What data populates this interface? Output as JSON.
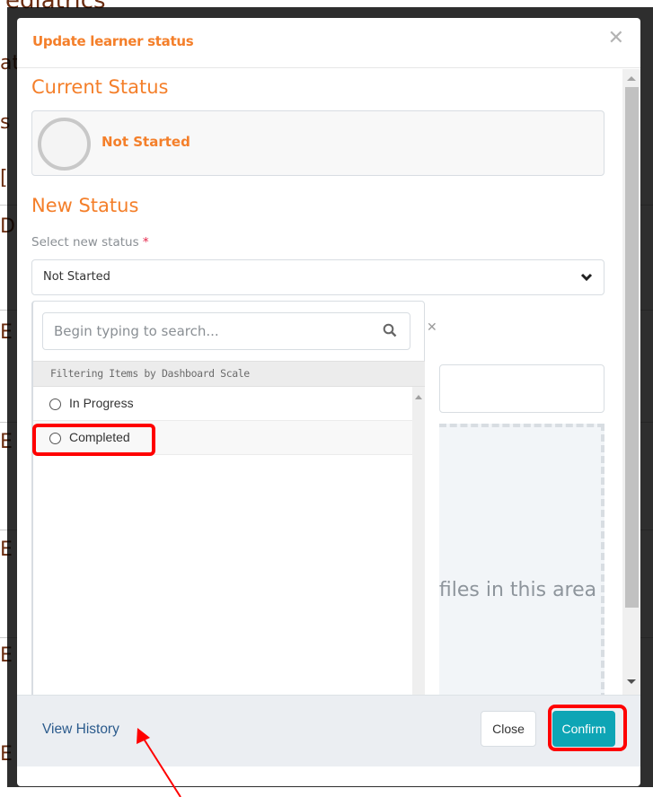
{
  "background_page": {
    "title_fragment": "ediatrics",
    "fragments": [
      "at",
      "s",
      "[",
      "D",
      "E"
    ]
  },
  "modal": {
    "title": "Update learner status",
    "close_icon": "close-x-icon",
    "current_status": {
      "heading": "Current Status",
      "value": "Not Started",
      "icon": "empty-circle-icon"
    },
    "new_status": {
      "heading": "New Status",
      "label": "Select new status",
      "required_marker": "*",
      "selected_value": "Not Started",
      "chevron_icon": "chevron-down-icon"
    },
    "dropdown": {
      "search_placeholder": "Begin typing to search...",
      "search_value": "",
      "search_icon": "search-icon",
      "clear_icon": "close-icon",
      "group_label": "Filtering Items by Dashboard Scale",
      "options": [
        {
          "label": "In Progress",
          "selected": false
        },
        {
          "label": "Completed",
          "selected": false
        }
      ]
    },
    "dropzone_text": "Drop files in this area to"
  },
  "footer": {
    "view_history_label": "View History",
    "close_label": "Close",
    "confirm_label": "Confirm"
  },
  "annotations": {
    "highlight_color": "#ff0000",
    "highlighted": [
      "Completed",
      "Confirm"
    ],
    "arrow_target": "View History"
  },
  "colors": {
    "accent_orange": "#f47f2a",
    "confirm_teal": "#0ea5b5",
    "link_blue": "#2a5a8c",
    "required_red": "#e5254a"
  }
}
